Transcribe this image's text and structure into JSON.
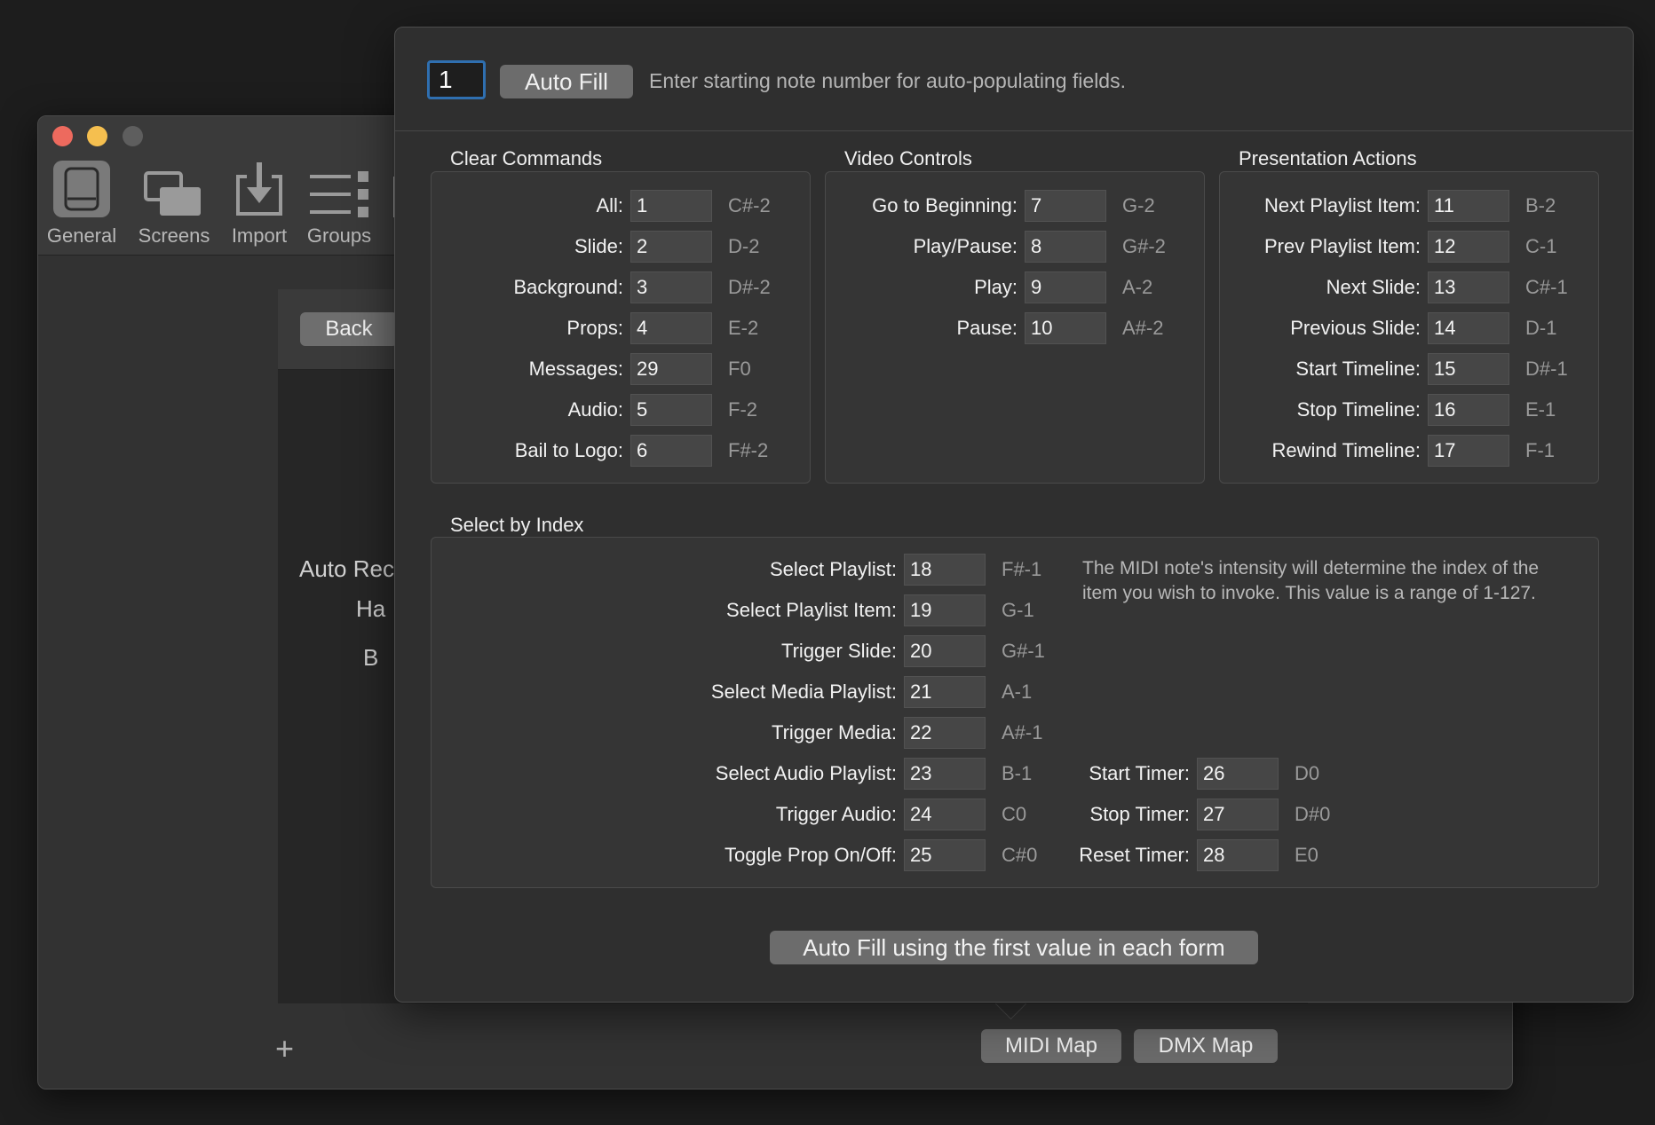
{
  "background_window": {
    "toolbar": [
      {
        "label": "General",
        "icon": "general-icon"
      },
      {
        "label": "Screens",
        "icon": "screens-icon"
      },
      {
        "label": "Import",
        "icon": "import-icon"
      },
      {
        "label": "Groups",
        "icon": "groups-icon"
      }
    ],
    "back_label": "Back",
    "partial_text_1": "Auto Rec",
    "partial_text_2": "Ha",
    "partial_text_3": "B",
    "add_label": "+",
    "tabs": [
      {
        "label": "MIDI Map"
      },
      {
        "label": "DMX Map"
      }
    ]
  },
  "panel": {
    "start_value": "1",
    "autofill_label": "Auto Fill",
    "hint": "Enter starting note number for auto-populating fields.",
    "clear_commands": {
      "title": "Clear Commands",
      "rows": [
        {
          "label": "All:",
          "value": "1",
          "note": "C#-2"
        },
        {
          "label": "Slide:",
          "value": "2",
          "note": "D-2"
        },
        {
          "label": "Background:",
          "value": "3",
          "note": "D#-2"
        },
        {
          "label": "Props:",
          "value": "4",
          "note": "E-2"
        },
        {
          "label": "Messages:",
          "value": "29",
          "note": "F0"
        },
        {
          "label": "Audio:",
          "value": "5",
          "note": "F-2"
        },
        {
          "label": "Bail to Logo:",
          "value": "6",
          "note": "F#-2"
        }
      ]
    },
    "video_controls": {
      "title": "Video Controls",
      "rows": [
        {
          "label": "Go to Beginning:",
          "value": "7",
          "note": "G-2"
        },
        {
          "label": "Play/Pause:",
          "value": "8",
          "note": "G#-2"
        },
        {
          "label": "Play:",
          "value": "9",
          "note": "A-2"
        },
        {
          "label": "Pause:",
          "value": "10",
          "note": "A#-2"
        }
      ]
    },
    "presentation_actions": {
      "title": "Presentation Actions",
      "rows": [
        {
          "label": "Next Playlist Item:",
          "value": "11",
          "note": "B-2"
        },
        {
          "label": "Prev Playlist Item:",
          "value": "12",
          "note": "C-1"
        },
        {
          "label": "Next Slide:",
          "value": "13",
          "note": "C#-1"
        },
        {
          "label": "Previous Slide:",
          "value": "14",
          "note": "D-1"
        },
        {
          "label": "Start Timeline:",
          "value": "15",
          "note": "D#-1"
        },
        {
          "label": "Stop Timeline:",
          "value": "16",
          "note": "E-1"
        },
        {
          "label": "Rewind Timeline:",
          "value": "17",
          "note": "F-1"
        }
      ]
    },
    "select_by_index": {
      "title": "Select by Index",
      "rows": [
        {
          "label": "Select Playlist:",
          "value": "18",
          "note": "F#-1"
        },
        {
          "label": "Select Playlist Item:",
          "value": "19",
          "note": "G-1"
        },
        {
          "label": "Trigger Slide:",
          "value": "20",
          "note": "G#-1"
        },
        {
          "label": "Select Media Playlist:",
          "value": "21",
          "note": "A-1"
        },
        {
          "label": "Trigger Media:",
          "value": "22",
          "note": "A#-1"
        },
        {
          "label": "Select Audio Playlist:",
          "value": "23",
          "note": "B-1"
        },
        {
          "label": "Trigger Audio:",
          "value": "24",
          "note": "C0"
        },
        {
          "label": "Toggle Prop On/Off:",
          "value": "25",
          "note": "C#0"
        }
      ],
      "timer_rows": [
        {
          "label": "Start Timer:",
          "value": "26",
          "note": "D0"
        },
        {
          "label": "Stop Timer:",
          "value": "27",
          "note": "D#0"
        },
        {
          "label": "Reset Timer:",
          "value": "28",
          "note": "E0"
        }
      ],
      "info": "The MIDI note's intensity will determine the index of the item you wish to invoke. This value is a range of 1-127."
    },
    "bottom_button": "Auto Fill using the first value in each form"
  }
}
